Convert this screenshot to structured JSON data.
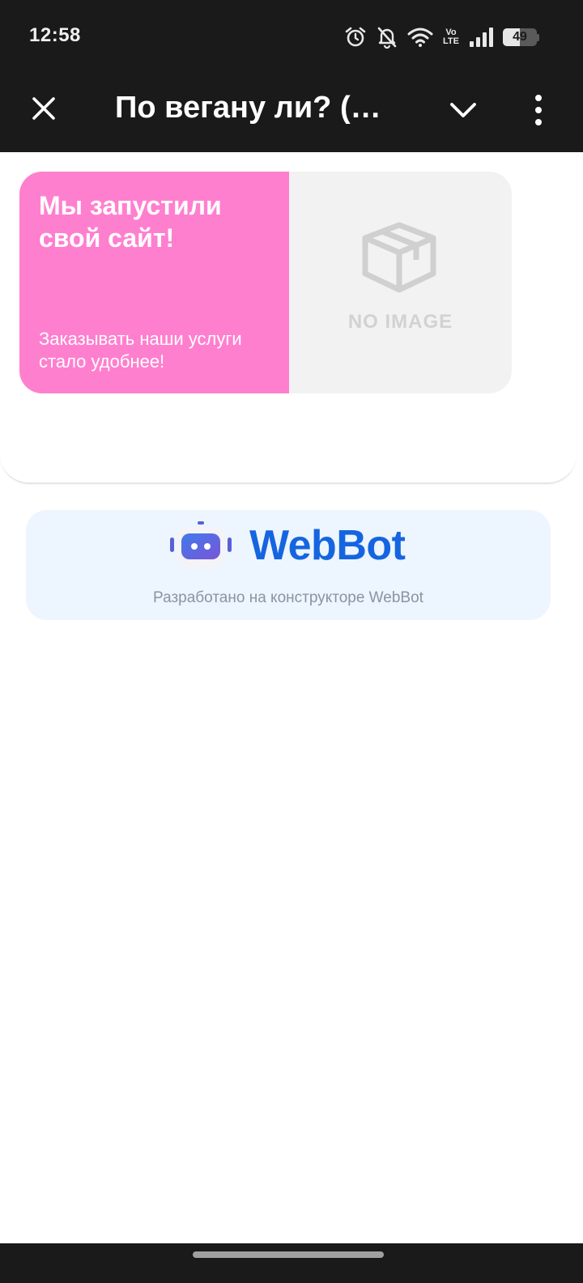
{
  "status_bar": {
    "time": "12:58",
    "volte_top": "Vo",
    "volte_bottom": "LTE",
    "battery_level": "49",
    "icons": [
      "alarm-icon",
      "bell-off-icon",
      "wifi-icon",
      "volte-icon",
      "signal-icon",
      "battery-icon"
    ]
  },
  "app_bar": {
    "title": "По вегану ли? (П...",
    "close_icon": "close-icon",
    "collapse_icon": "chevron-down-icon",
    "more_icon": "more-vert-icon"
  },
  "banner": {
    "title": "Мы запустили свой сайт!",
    "subtitle": "Заказывать наши услуги стало удобнее!",
    "image_placeholder": "NO IMAGE",
    "background_color": "#ff7fcf"
  },
  "footer_card": {
    "brand": "WebBot",
    "caption": "Разработано на конструкторе WebBot",
    "brand_color": "#1565e0"
  }
}
